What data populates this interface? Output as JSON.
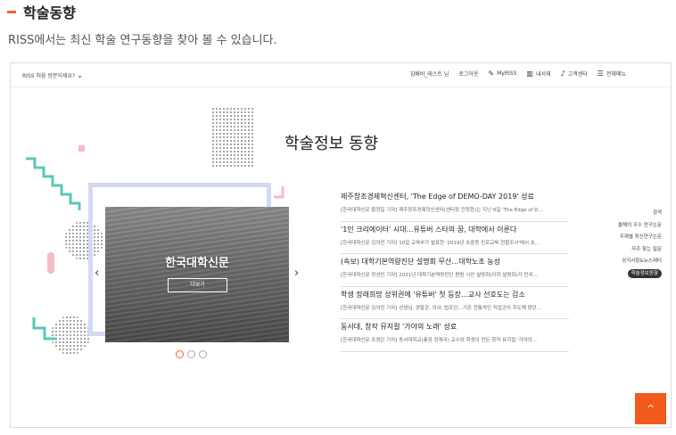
{
  "section": {
    "title": "학술동향",
    "subtitle": "RISS에서는 최신 학술 연구동향을 찾아 볼 수 있습니다."
  },
  "topnav": {
    "first_visit": "RISS 처음 방문이세요?",
    "items": [
      {
        "label": "김배비_테스트 님",
        "icon": ""
      },
      {
        "label": "로그아웃",
        "icon": ""
      },
      {
        "label": "MyRISS",
        "icon": "pencil-icon"
      },
      {
        "label": "내서재",
        "icon": "library-icon"
      },
      {
        "label": "고객센터",
        "icon": "mic-icon"
      },
      {
        "label": "전체메뉴",
        "icon": "hamburger-icon"
      }
    ]
  },
  "main": {
    "title": "학술정보 동향",
    "carousel": {
      "label": "한국대학신문",
      "more": "더보기",
      "prev": "‹",
      "next": "›",
      "active_index": 0,
      "count": 3
    },
    "news": [
      {
        "headline": "제주창조경제혁신센터, 'The Edge of DEMO-DAY 2019' 성료",
        "desc": "[한국대학신문 황정일 기자] 제주창조경제혁신센터(센터장 전정환)는 지난 6일 'The Edge of D..."
      },
      {
        "headline": "'1인 크리에이터' 시대…유튜버 스타의 꿈, 대학에서 이룬다",
        "desc": "[한국대학신문 김의진 기자] 10일 교육부가 발표한 '2019년 초중등 진로교육 현황조사'에서 초..."
      },
      {
        "headline": "(속보) 대학기본역량진단 설명회 무산…대학노조 농성",
        "desc": "[한국대학신문 정성민 기자] 2021년 대학기본역량진단 편람 시안 설명회(이하 설명회)가 전국..."
      },
      {
        "headline": "학생 장래희망 상위권에 '유튜버' 첫 등장…교사 선호도는 감소",
        "desc": "[한국대학신문 김의진 기자] 선생님, 경찰관, 의사, 법조인…기존 전통적인 직업군이 주도해 왔던..."
      },
      {
        "headline": "동서대, 창작 뮤지컬 '가야의 노래' 성료",
        "desc": "[한국대학신문 조영은 기자] 동서대학교(총장 장제국) 교수와 학생이 만든 창작 뮤지컬 '가야의..."
      }
    ]
  },
  "quick": [
    "검색",
    "올해의 우수 연구논문",
    "주제별 최신연구논문",
    "자주 찾는 질문",
    "공지사항&뉴스레터",
    "학술정보동향"
  ],
  "top_button": "^",
  "colors": {
    "accent": "#f26522",
    "teal": "#5bc6b8",
    "pink": "#f7b8c8",
    "lavender": "#d4d9f2"
  }
}
